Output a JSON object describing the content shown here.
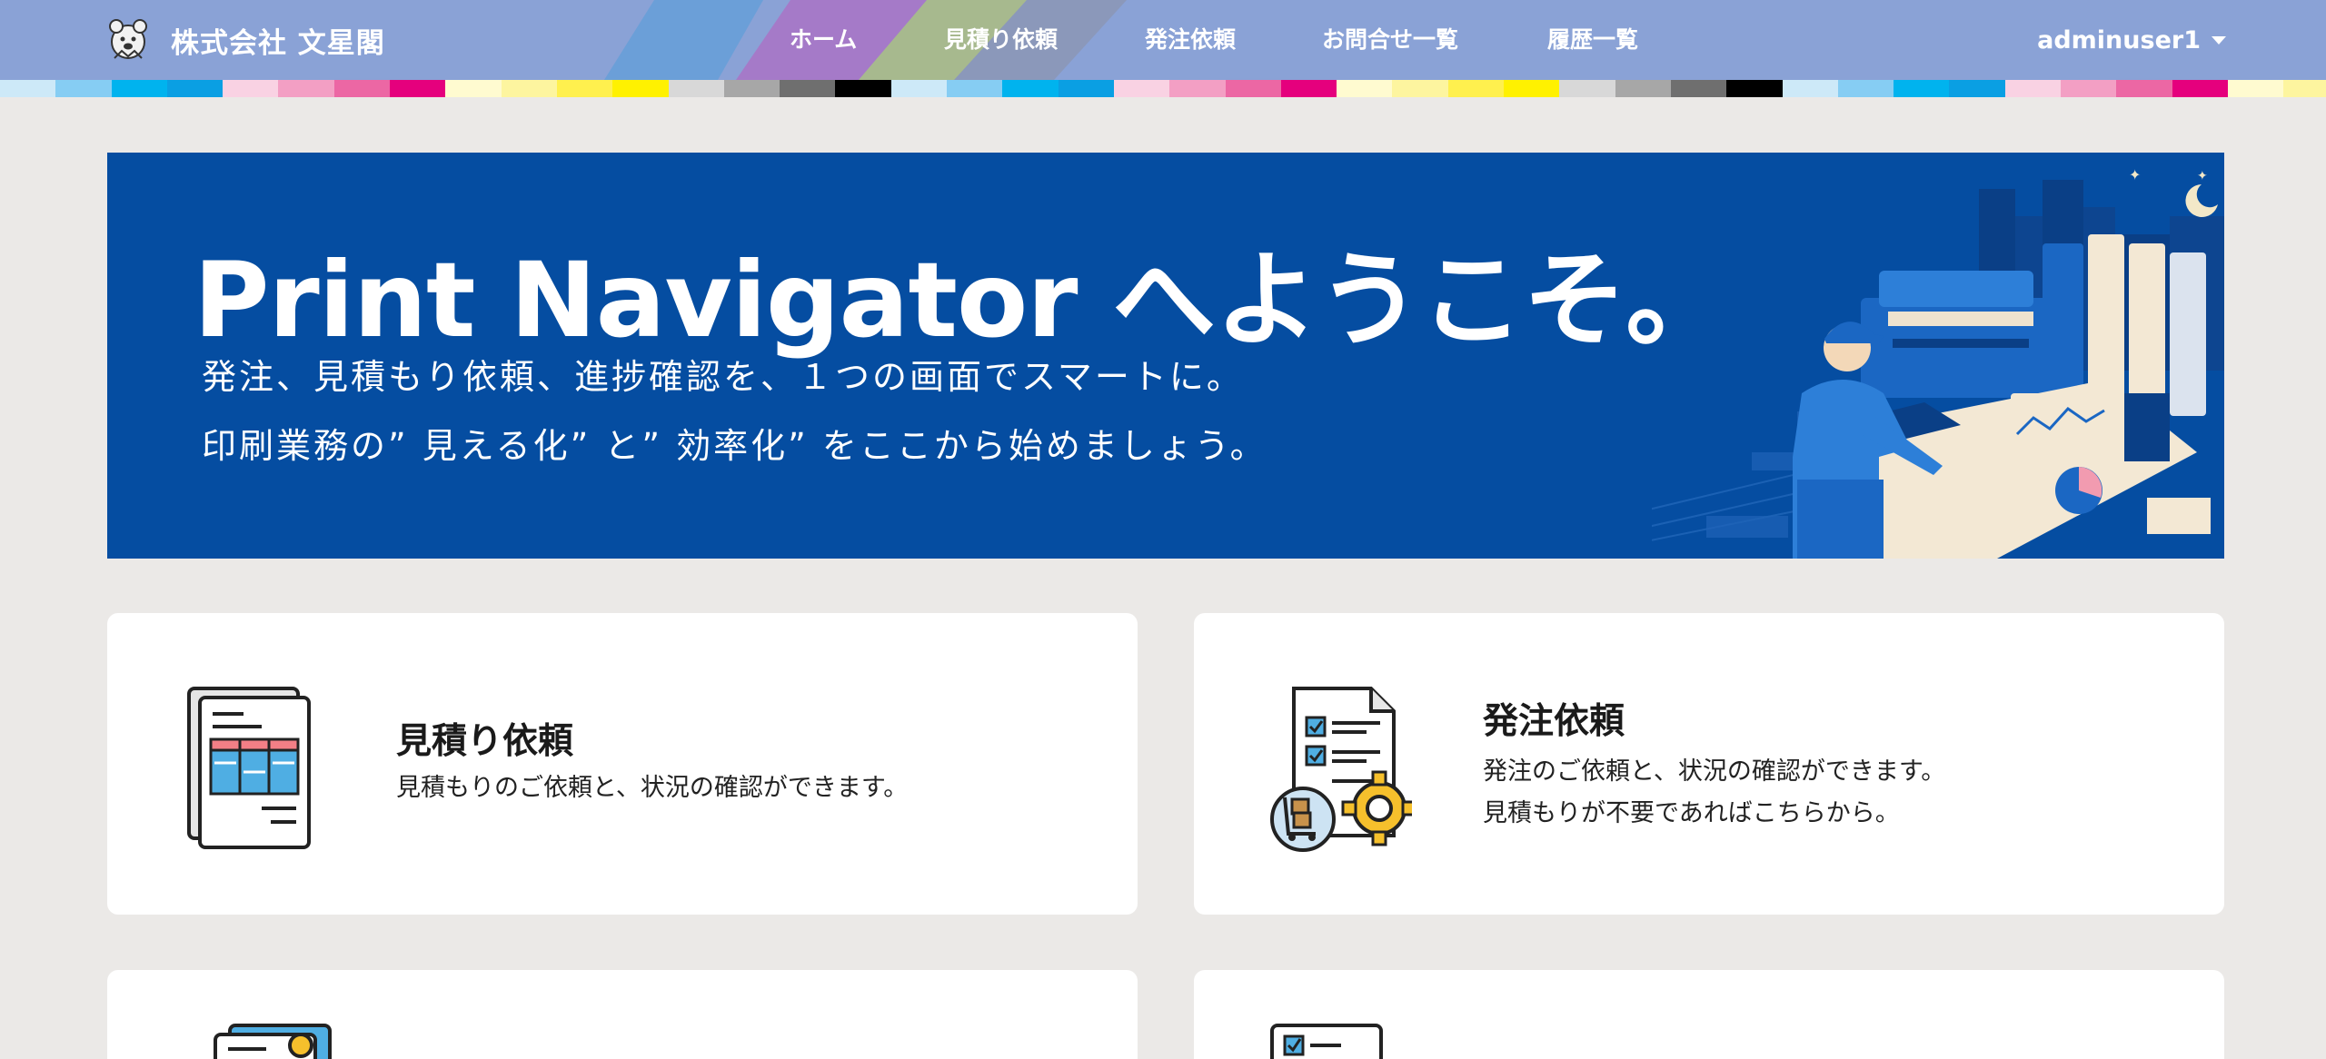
{
  "header": {
    "company_name": "株式会社 文星閣",
    "nav": [
      {
        "label": "ホーム",
        "active": true
      },
      {
        "label": "見積り依頼"
      },
      {
        "label": "発注依頼"
      },
      {
        "label": "お問合せ一覧"
      },
      {
        "label": "履歴一覧"
      }
    ],
    "user": "adminuser1"
  },
  "colors": {
    "header_bg": "#8aa2d6",
    "hero_bg": "#054da1",
    "page_bg": "#ebe9e7",
    "nav_active_bg": "#a57ac8",
    "nav_green_bg": "#a7b98e",
    "cmyk_strip": [
      "#cde9f8",
      "#86cdf3",
      "#00b3ee",
      "#0a9fe3",
      "#f9d2e3",
      "#f39fc4",
      "#ec67a4",
      "#e5007d",
      "#fffbd0",
      "#fdf59f",
      "#fff04e",
      "#fff100",
      "#d8d8d8",
      "#a7a7a7",
      "#6f6f6f",
      "#000000"
    ]
  },
  "hero": {
    "title": "Print Navigator へようこそ。",
    "line1": "発注、見積もり依頼、進捗確認を、１つの画面でスマートに。",
    "line2": "印刷業務の” 見える化” と” 効率化” をここから始めましょう。"
  },
  "cards": [
    {
      "title": "見積り依頼",
      "desc": [
        "見積もりのご依頼と、状況の確認ができます。"
      ],
      "icon": "estimate-document-icon"
    },
    {
      "title": "発注依頼",
      "desc": [
        "発注のご依頼と、状況の確認ができます。",
        "見積もりが不要であればこちらから。"
      ],
      "icon": "order-document-gear-icon"
    },
    {
      "title": "",
      "desc": [],
      "icon": "inquiry-card-icon"
    },
    {
      "title": "",
      "desc": [],
      "icon": "history-checklist-icon"
    }
  ]
}
